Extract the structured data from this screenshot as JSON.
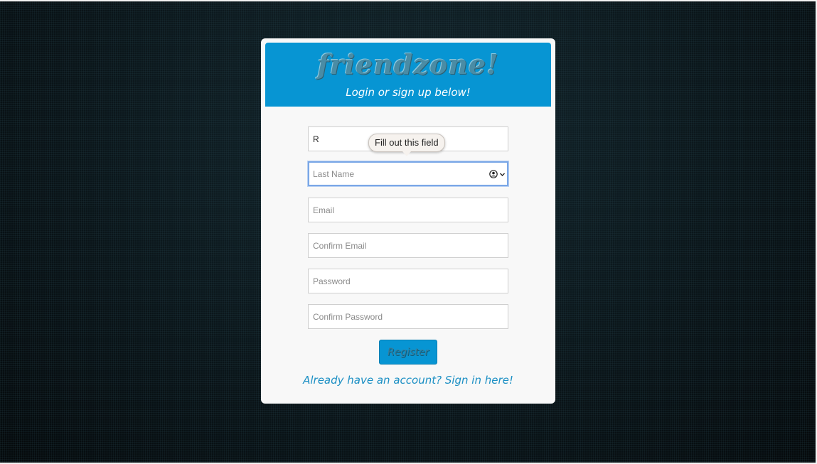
{
  "header": {
    "brand": "friendzone!",
    "subtitle": "Login or sign up below!"
  },
  "form": {
    "first_name": {
      "value": "R"
    },
    "last_name": {
      "placeholder": "Last Name",
      "value": ""
    },
    "email": {
      "placeholder": "Email"
    },
    "confirm_email": {
      "placeholder": "Confirm Email"
    },
    "password": {
      "placeholder": "Password"
    },
    "confirm_password": {
      "placeholder": "Confirm Password"
    },
    "register_label": "Register",
    "signin_link": "Already have an account? Sign in here!"
  },
  "validation_tooltip": {
    "text": "Fill out this field"
  },
  "autofill_icons": [
    "user-circle-icon",
    "chevron-down-icon"
  ],
  "colors": {
    "accent": "#0795d3",
    "card": "#f8f8f8",
    "link": "#1b8fc4",
    "focus_ring": "#7aa7e6"
  }
}
